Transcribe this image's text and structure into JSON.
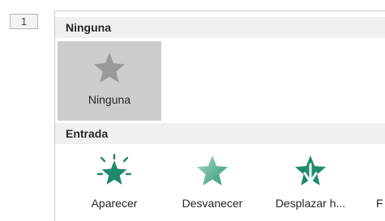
{
  "slide_number": "1",
  "sections": {
    "none": {
      "title": "Ninguna",
      "items": [
        {
          "label": "Ninguna",
          "icon": "star-gray-icon",
          "selected": true
        }
      ]
    },
    "entrance": {
      "title": "Entrada",
      "items": [
        {
          "label": "Aparecer",
          "icon": "appear-star-icon"
        },
        {
          "label": "Desvanecer",
          "icon": "fade-star-icon"
        },
        {
          "label": "Desplazar h...",
          "icon": "fly-in-star-icon"
        },
        {
          "label": "F"
        }
      ]
    }
  },
  "colors": {
    "accent_green": "#1e8a6d",
    "fade_green": "#5cb394",
    "section_bg": "#f0f0f0",
    "selected_bg": "#cdcdcd"
  }
}
